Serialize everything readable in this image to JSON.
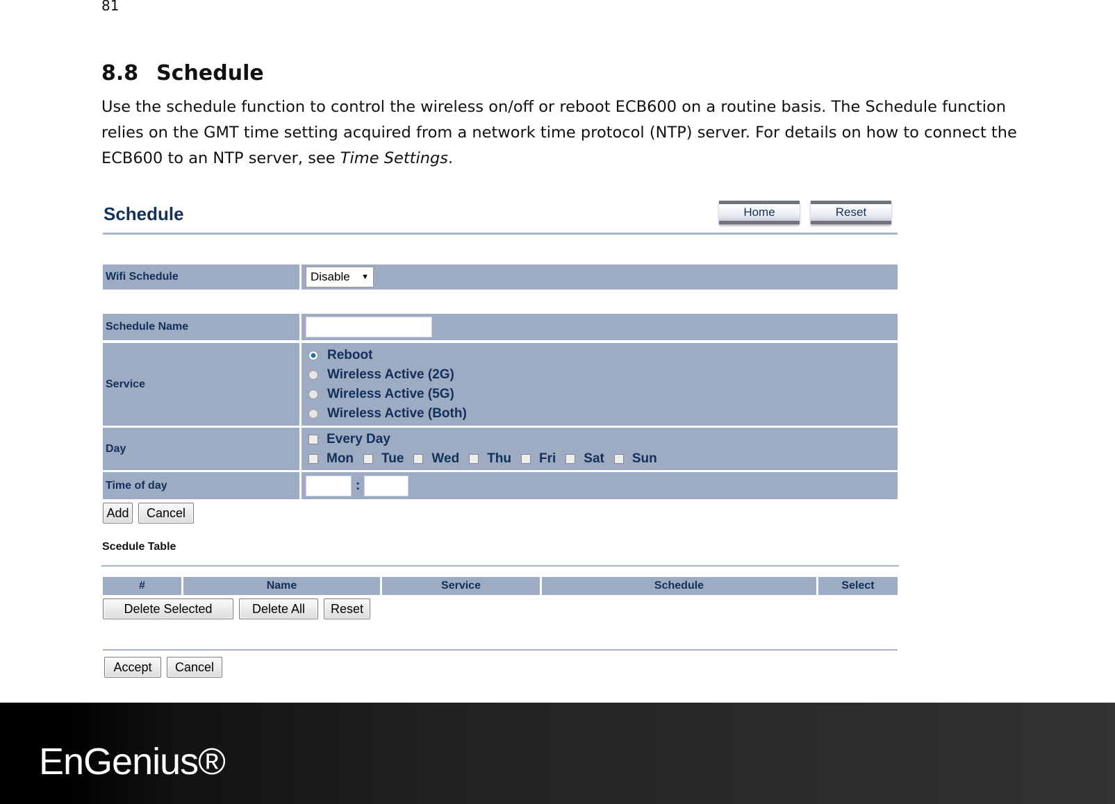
{
  "page_number": "81",
  "section": {
    "number": "8.8",
    "title": "Schedule"
  },
  "paragraph": {
    "text": "Use the schedule function to control the wireless on/off or reboot ECB600 on a routine basis. The Schedule function relies on the GMT time setting acquired from a network time protocol (NTP) server. For details on how to connect the ECB600 to an NTP server, see ",
    "link": "Time Settings",
    "end": "."
  },
  "ui": {
    "title": "Schedule",
    "home": "Home",
    "reset": "Reset",
    "wifi_schedule": {
      "label": "Wifi Schedule",
      "value": "Disable"
    },
    "schedule_name": {
      "label": "Schedule Name",
      "value": ""
    },
    "service": {
      "label": "Service",
      "options": [
        "Reboot",
        "Wireless Active (2G)",
        "Wireless Active (5G)",
        "Wireless Active (Both)"
      ],
      "selected": "Reboot"
    },
    "day": {
      "label": "Day",
      "every_day": "Every Day",
      "days": [
        "Mon",
        "Tue",
        "Wed",
        "Thu",
        "Fri",
        "Sat",
        "Sun"
      ]
    },
    "time": {
      "label": "Time of day",
      "separator": ":"
    },
    "add": "Add",
    "cancel": "Cancel",
    "table_label": "Scedule Table",
    "columns": [
      "#",
      "Name",
      "Service",
      "Schedule",
      "Select"
    ],
    "delete_selected": "Delete Selected",
    "delete_all": "Delete All",
    "table_reset": "Reset",
    "accept": "Accept",
    "cancel2": "Cancel"
  },
  "footer": {
    "logo": "EnGenius®"
  }
}
